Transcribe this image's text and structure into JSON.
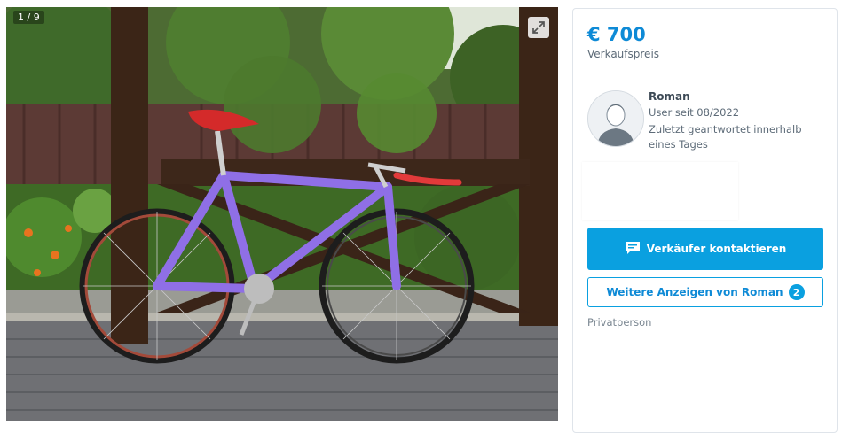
{
  "gallery": {
    "counter": "1 / 9",
    "expand_icon": "expand-icon"
  },
  "listing": {
    "price": "€ 700",
    "price_label": "Verkaufspreis"
  },
  "seller": {
    "name": "Roman",
    "member_since": "User seit 08/2022",
    "response_time": "Zuletzt geantwortet innerhalb eines Tages",
    "avatar_icon": "user-avatar-icon",
    "type": "Privatperson"
  },
  "actions": {
    "contact_label": "Verkäufer kontaktieren",
    "contact_icon": "chat-icon",
    "more_ads_label": "Weitere Anzeigen von Roman",
    "more_ads_count": "2"
  },
  "colors": {
    "accent": "#0aa0e0",
    "price": "#0e8ad6"
  }
}
